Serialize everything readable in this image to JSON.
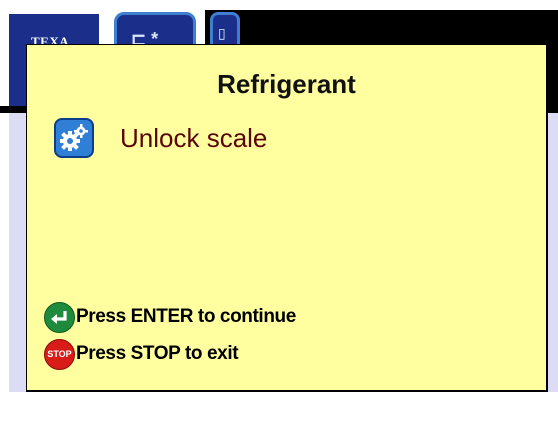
{
  "background": {
    "brand_logo": "TEXA",
    "tabs": [
      {
        "icon": "refrigerant-tab-icon"
      },
      {
        "icon": "bottle-tab-icon"
      }
    ]
  },
  "dialog": {
    "title": "Refrigerant",
    "item": {
      "icon": "gears-icon",
      "label": "Unlock scale"
    },
    "actions": [
      {
        "icon": "enter-icon",
        "label": "Press ENTER to continue"
      },
      {
        "icon": "stop-icon",
        "icon_text": "STOP",
        "label": "Press STOP to exit"
      }
    ]
  },
  "colors": {
    "dialog_background": "#ffff9f",
    "item_text": "#5a0505",
    "brand_blue": "#1b2f8a",
    "enter_green": "#1e8a3c",
    "stop_red": "#d81c18"
  }
}
